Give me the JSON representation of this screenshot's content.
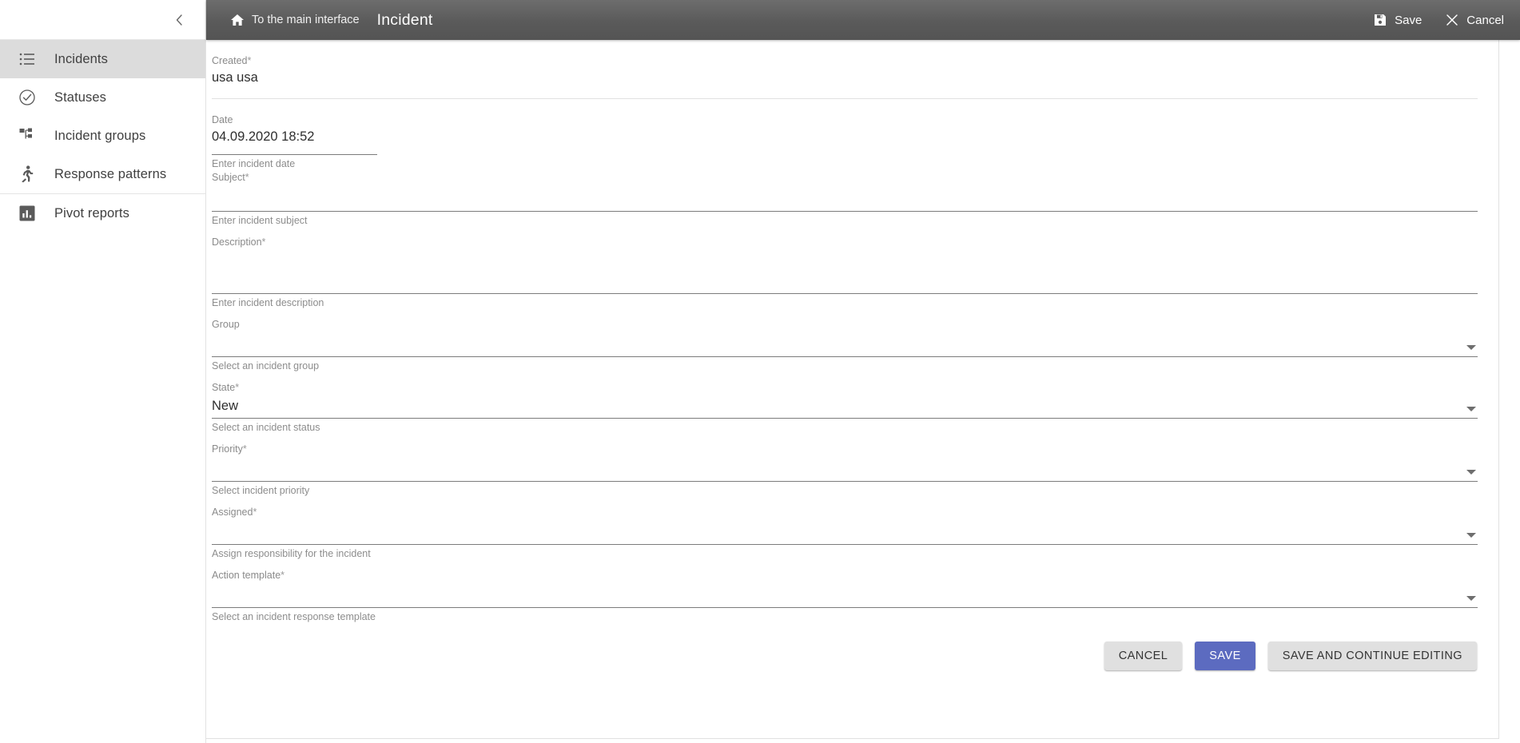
{
  "sidebar": {
    "collapse_icon": "chevron-left-icon",
    "items": [
      {
        "label": "Incidents",
        "icon": "list-icon",
        "active": true
      },
      {
        "label": "Statuses",
        "icon": "check-circle-icon",
        "active": false
      },
      {
        "label": "Incident groups",
        "icon": "sitemap-icon",
        "active": false
      },
      {
        "label": "Response patterns",
        "icon": "running-person-icon",
        "active": false
      },
      {
        "label": "Pivot reports",
        "icon": "bar-chart-icon",
        "active": false
      }
    ]
  },
  "topbar": {
    "home_icon": "home-icon",
    "breadcrumb": "To the main interface",
    "title": "Incident",
    "save_icon": "floppy-disk-icon",
    "save_label": "Save",
    "cancel_icon": "close-x-icon",
    "cancel_label": "Cancel"
  },
  "form": {
    "created": {
      "label": "Created",
      "required_mark": "*",
      "value": "usa usa"
    },
    "date": {
      "label": "Date",
      "required_mark": "",
      "value": "04.09.2020 18:52",
      "hint": "Enter incident date"
    },
    "subject": {
      "label": "Subject",
      "required_mark": "*",
      "value": "",
      "hint": "Enter incident subject"
    },
    "description": {
      "label": "Description",
      "required_mark": "*",
      "value": "",
      "hint": "Enter incident description"
    },
    "group": {
      "label": "Group",
      "required_mark": "",
      "value": "",
      "hint": "Select an incident group",
      "caret_icon": "chevron-down-icon"
    },
    "state": {
      "label": "State",
      "required_mark": "*",
      "value": "New",
      "hint": "Select an incident status",
      "caret_icon": "chevron-down-icon"
    },
    "priority": {
      "label": "Priority",
      "required_mark": "*",
      "value": "",
      "hint": "Select incident priority",
      "caret_icon": "chevron-down-icon"
    },
    "assigned": {
      "label": "Assigned",
      "required_mark": "*",
      "value": "",
      "hint": "Assign responsibility for the incident",
      "caret_icon": "chevron-down-icon"
    },
    "action_template": {
      "label": "Action template",
      "required_mark": "*",
      "value": "",
      "hint": "Select an incident response template",
      "caret_icon": "chevron-down-icon"
    }
  },
  "footer": {
    "cancel_label": "CANCEL",
    "save_label": "SAVE",
    "save_continue_label": "SAVE AND CONTINUE EDITING"
  },
  "colors": {
    "primary": "#5c6bc0",
    "topbar_dark": "#5a5a5a",
    "active_nav": "#dcdcdc",
    "underline": "#7b7b7b"
  }
}
